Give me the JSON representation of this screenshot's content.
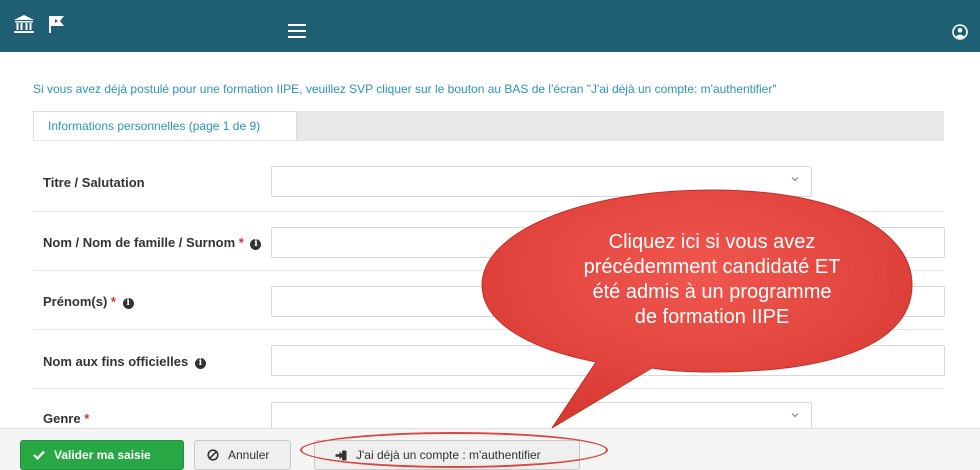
{
  "header": {
    "logo_icon": "university-building-icon",
    "secondary_icon": "flag-door-icon",
    "menu_icon": "hamburger-icon",
    "user_icon": "user-circle-icon"
  },
  "notice": "Si vous avez déjà postulé pour une formation IIPE, veuillez SVP cliquer sur le bouton au BAS de l'écran \"J'ai déjà un compte: m'authentifier\"",
  "tab": {
    "label": "Informations personnelles (page 1 de 9)"
  },
  "form": {
    "fields": [
      {
        "label": "Titre / Salutation",
        "required": false,
        "info": false,
        "type": "select",
        "value": ""
      },
      {
        "label": "Nom / Nom de famille / Surnom",
        "required": true,
        "info": true,
        "type": "text",
        "value": ""
      },
      {
        "label": "Prénom(s)",
        "required": true,
        "info": true,
        "type": "text",
        "value": ""
      },
      {
        "label": "Nom aux fins officielles",
        "required": false,
        "info": true,
        "type": "text",
        "value": ""
      },
      {
        "label": "Genre",
        "required": true,
        "info": false,
        "type": "select",
        "value": ""
      }
    ],
    "required_marker": "*",
    "info_icon": "info-circle-icon"
  },
  "callout": {
    "lines": [
      "Cliquez ici si vous avez",
      "précédemment candidaté ET",
      "été admis à un programme",
      "de formation IIPE"
    ],
    "color": "#e8413a"
  },
  "footer": {
    "submit_label": "Valider ma saisie",
    "submit_icon": "check-icon",
    "cancel_label": "Annuler",
    "cancel_icon": "ban-icon",
    "login_label": "J'ai déjà un compte : m'authentifier",
    "login_icon": "sign-in-icon"
  },
  "colors": {
    "header_bg": "#1f5f73",
    "accent_link": "#2b94b8",
    "submit_green": "#27a844",
    "required_red": "#d9312b"
  }
}
